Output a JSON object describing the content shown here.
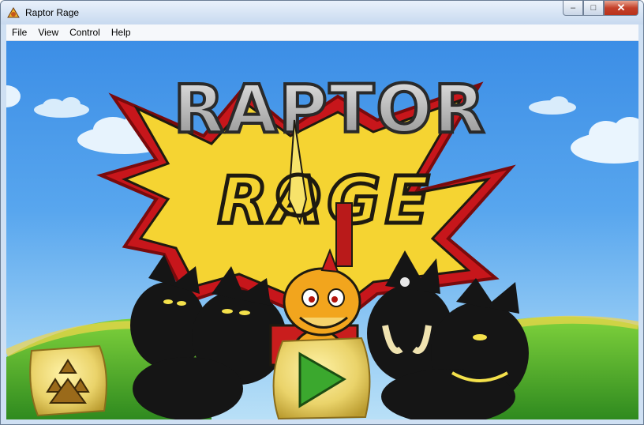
{
  "window": {
    "title": "Raptor Rage"
  },
  "menu": {
    "file": "File",
    "view": "View",
    "control": "Control",
    "help": "Help"
  },
  "game": {
    "logo_line1": "RAPTOR",
    "logo_line2": "RAGE",
    "icons": {
      "app": "raptor-app-icon",
      "options": "triangle-options-icon",
      "play": "play-triangle-icon"
    },
    "colors": {
      "sky": "#4a9be9",
      "grass": "#47a82b",
      "logo_yellow": "#f5d432",
      "logo_red": "#c7161b",
      "button_stone": "#e7d36b"
    }
  }
}
